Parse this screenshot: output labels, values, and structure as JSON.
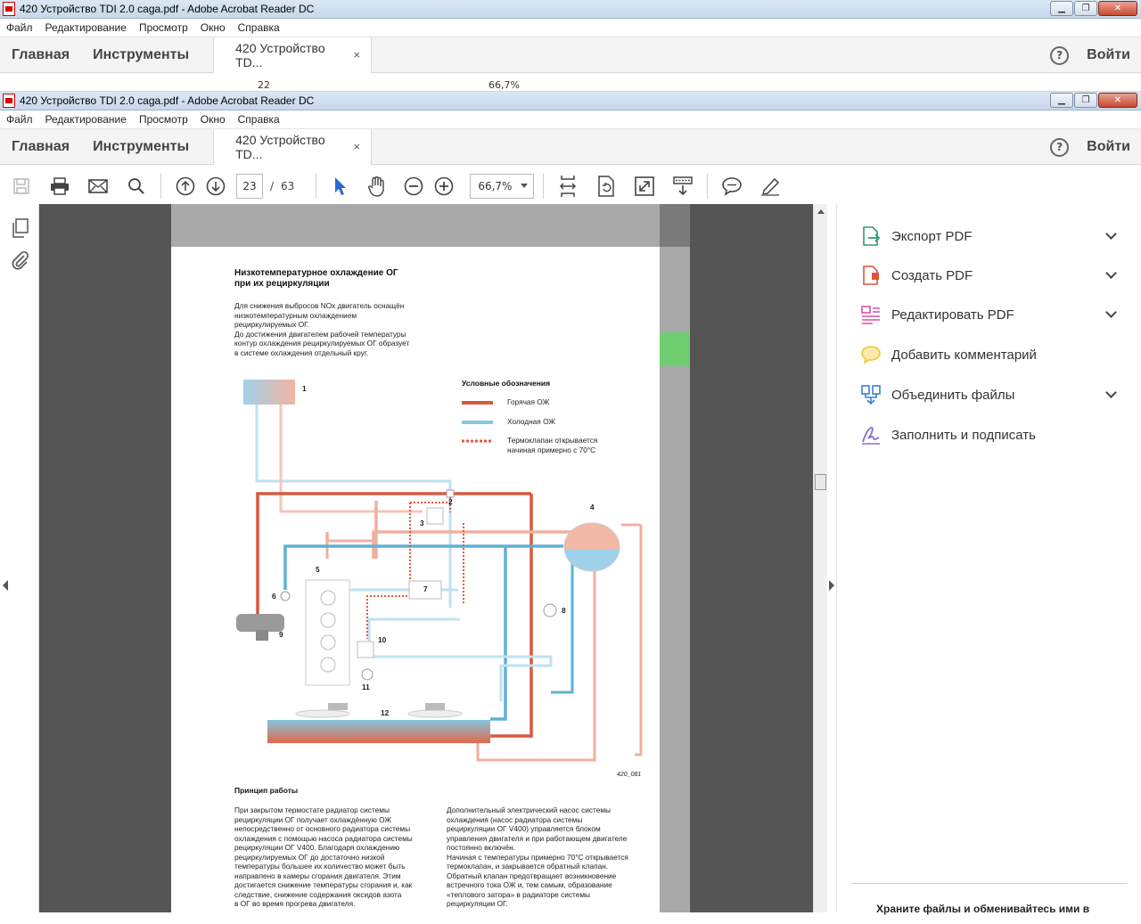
{
  "window": {
    "title": "420 Устройство TDI 2.0 caga.pdf - Adobe Acrobat Reader DC"
  },
  "menu": [
    "Файл",
    "Редактирование",
    "Просмотр",
    "Окно",
    "Справка"
  ],
  "nav": {
    "home": "Главная",
    "tools": "Инструменты",
    "doc_tab": "420 Устройство TD...",
    "doc_tab_close": "×",
    "help": "?",
    "signin": "Войти"
  },
  "toolbar": {
    "page_current": "23",
    "page_sep": "/",
    "page_total": "63",
    "zoom": "66,7%",
    "bg_page_current": "22",
    "bg_zoom": "66,7%"
  },
  "right_panel": {
    "tools": [
      {
        "label": "Экспорт PDF",
        "has_menu": true,
        "color": "#2d9b7a"
      },
      {
        "label": "Создать PDF",
        "has_menu": true,
        "color": "#e0523e"
      },
      {
        "label": "Редактировать PDF",
        "has_menu": true,
        "color": "#d94fb0"
      },
      {
        "label": "Добавить комментарий",
        "has_menu": false,
        "color": "#f2c53d"
      },
      {
        "label": "Объединить файлы",
        "has_menu": true,
        "color": "#3a7fd5"
      },
      {
        "label": "Заполнить и подписать",
        "has_menu": false,
        "color": "#8a6ad8"
      }
    ],
    "promo": "Храните файлы и обменивайтесь ими в"
  },
  "document": {
    "title_l1": "Низкотемпературное охлаждение ОГ",
    "title_l2": "при их рециркуляции",
    "intro": [
      "Для снижения выбросов NOx двигатель оснащён",
      "низкотемпературным охлаждением",
      "рециркулируемых ОГ.",
      "До достижения двигателем рабочей температуры",
      "контур охлаждения рециркулируемых ОГ образует",
      "в системе охлаждения отдельный круг."
    ],
    "legend_title": "Условные обозначения",
    "legend": [
      {
        "label": "Горячая ОЖ",
        "color": "#d9583f"
      },
      {
        "label": "Холодная ОЖ",
        "color": "#86c7e2"
      },
      {
        "label": "Термоклапан открывается",
        "label2": "начиная примерно с 70°С",
        "color": "#e4573e"
      }
    ],
    "numbers": [
      "1",
      "2",
      "3",
      "4",
      "5",
      "6",
      "7",
      "8",
      "9",
      "10",
      "11",
      "12"
    ],
    "fig_code": "420_081",
    "section_title": "Принцип работы",
    "col1": [
      "При закрытом термостате радиатор системы",
      "рециркуляции ОГ получает охлаждённую ОЖ",
      "непосредственно от основного радиатора системы",
      "охлаждения с помощью насоса радиатора системы",
      "рециркуляции ОГ V400. Благодаря охлаждению",
      "рециркулируемых ОГ до достаточно низкой",
      "температуры большее их количество может быть",
      "направлено в камеры сгорания двигателя. Этим",
      "достигается снижение температуры сгорания и, как",
      "следствие, снижение содержания оксидов азота",
      "в ОГ во время прогрева двигателя."
    ],
    "col2": [
      "Дополнительный электрический насос системы",
      "охлаждения (насос радиатора системы",
      "рециркуляции ОГ V400) управляется блоком",
      "управления двигателя и при работающем двигателе",
      "постоянно включён.",
      "Начиная с температуры примерно 70°С открывается",
      "термоклапан, и закрывается обратный клапан.",
      "Обратный клапан предотвращает возникновение",
      "встречного тока ОЖ и, тем самым, образование",
      "«теплового затора» в радиаторе системы",
      "рециркуляции ОГ."
    ]
  },
  "colors": {
    "hot": "#d9583f",
    "cold": "#86c7e2",
    "viewer_bg": "#555555",
    "accent_green": "#6fce6f"
  }
}
